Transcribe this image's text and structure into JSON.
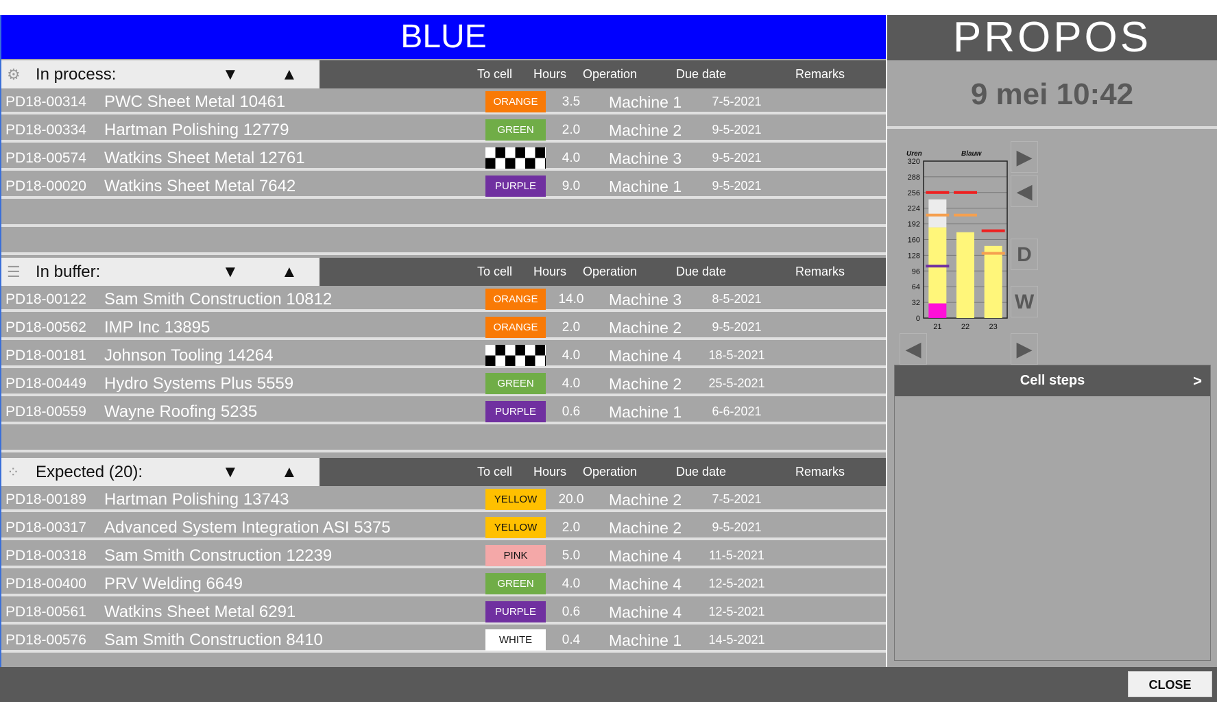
{
  "title": "BLUE",
  "logo": "PROPOS",
  "datetime": "9 mei 10:42",
  "columns": {
    "to_cell": "To cell",
    "hours": "Hours",
    "operation": "Operation",
    "due_date": "Due date",
    "remarks": "Remarks"
  },
  "colors": {
    "ORANGE": "#f97a06",
    "GREEN": "#70ad47",
    "PURPLE": "#7030a0",
    "YELLOW": "#ffc000",
    "PINK": "#f4a8a8",
    "WHITE": "#ffffff",
    "header": "#0000ff"
  },
  "sections": [
    {
      "label": "In process:",
      "icon": "gears-icon",
      "empty_rows": 2,
      "rows": [
        {
          "id": "PD18-00314",
          "name": "PWC Sheet Metal 10461",
          "cell": "ORANGE",
          "hours": "3.5",
          "operation": "Machine 1",
          "due": "7-5-2021"
        },
        {
          "id": "PD18-00334",
          "name": "Hartman Polishing 12779",
          "cell": "GREEN",
          "hours": "2.0",
          "operation": "Machine 2",
          "due": "9-5-2021"
        },
        {
          "id": "PD18-00574",
          "name": "Watkins Sheet Metal 12761",
          "cell": "CHECKERED",
          "hours": "4.0",
          "operation": "Machine 3",
          "due": "9-5-2021"
        },
        {
          "id": "PD18-00020",
          "name": "Watkins Sheet Metal 7642",
          "cell": "PURPLE",
          "hours": "9.0",
          "operation": "Machine 1",
          "due": "9-5-2021"
        }
      ]
    },
    {
      "label": "In buffer:",
      "icon": "list-icon",
      "empty_rows": 1,
      "rows": [
        {
          "id": "PD18-00122",
          "name": "Sam Smith Construction 10812",
          "cell": "ORANGE",
          "hours": "14.0",
          "operation": "Machine 3",
          "due": "8-5-2021"
        },
        {
          "id": "PD18-00562",
          "name": "IMP Inc 13895",
          "cell": "ORANGE",
          "hours": "2.0",
          "operation": "Machine 2",
          "due": "9-5-2021"
        },
        {
          "id": "PD18-00181",
          "name": "Johnson Tooling 14264",
          "cell": "CHECKERED",
          "hours": "4.0",
          "operation": "Machine 4",
          "due": "18-5-2021"
        },
        {
          "id": "PD18-00449",
          "name": "Hydro Systems Plus 5559",
          "cell": "GREEN",
          "hours": "4.0",
          "operation": "Machine 2",
          "due": "25-5-2021"
        },
        {
          "id": "PD18-00559",
          "name": "Wayne Roofing 5235",
          "cell": "PURPLE",
          "hours": "0.6",
          "operation": "Machine 1",
          "due": "6-6-2021"
        }
      ]
    },
    {
      "label": "Expected (20):",
      "icon": "grid-icon",
      "empty_rows": 0,
      "rows": [
        {
          "id": "PD18-00189",
          "name": "Hartman Polishing 13743",
          "cell": "YELLOW",
          "hours": "20.0",
          "operation": "Machine 2",
          "due": "7-5-2021"
        },
        {
          "id": "PD18-00317",
          "name": "Advanced System Integration ASI 5375",
          "cell": "YELLOW",
          "hours": "2.0",
          "operation": "Machine 2",
          "due": "9-5-2021"
        },
        {
          "id": "PD18-00318",
          "name": "Sam Smith Construction 12239",
          "cell": "PINK",
          "hours": "5.0",
          "operation": "Machine 4",
          "due": "11-5-2021"
        },
        {
          "id": "PD18-00400",
          "name": "PRV Welding 6649",
          "cell": "GREEN",
          "hours": "4.0",
          "operation": "Machine 4",
          "due": "12-5-2021"
        },
        {
          "id": "PD18-00561",
          "name": "Watkins Sheet Metal 6291",
          "cell": "PURPLE",
          "hours": "0.6",
          "operation": "Machine 4",
          "due": "12-5-2021"
        },
        {
          "id": "PD18-00576",
          "name": "Sam Smith Construction 8410",
          "cell": "WHITE",
          "hours": "0.4",
          "operation": "Machine 1",
          "due": "14-5-2021"
        }
      ]
    }
  ],
  "chart_data": {
    "type": "bar",
    "title": "Blauw",
    "ylabel": "Uren",
    "categories": [
      "21",
      "22",
      "23"
    ],
    "ylim": [
      0,
      320
    ],
    "yticks": [
      0,
      32,
      64,
      96,
      128,
      160,
      192,
      224,
      256,
      288,
      320
    ],
    "grid": true,
    "stacks": [
      {
        "color": "#ff10d8",
        "values": [
          30,
          0,
          0
        ]
      },
      {
        "color": "#fff67a",
        "values": [
          155,
          175,
          147
        ]
      },
      {
        "color": "#ececec",
        "values": [
          57,
          0,
          0
        ]
      }
    ],
    "markers": [
      {
        "color": "#ee2020",
        "values": [
          256,
          256,
          178
        ]
      },
      {
        "color": "#f5a050",
        "values": [
          210,
          210,
          132
        ]
      },
      {
        "color": "#7030a0",
        "values": [
          106,
          null,
          null
        ]
      }
    ]
  },
  "chart_nav": {
    "next": "▶",
    "prev": "◀",
    "day": "D",
    "week": "W",
    "left": "◀",
    "right": "▶"
  },
  "cell_steps": {
    "label": "Cell steps",
    "arrow": ">"
  },
  "close_label": "CLOSE"
}
